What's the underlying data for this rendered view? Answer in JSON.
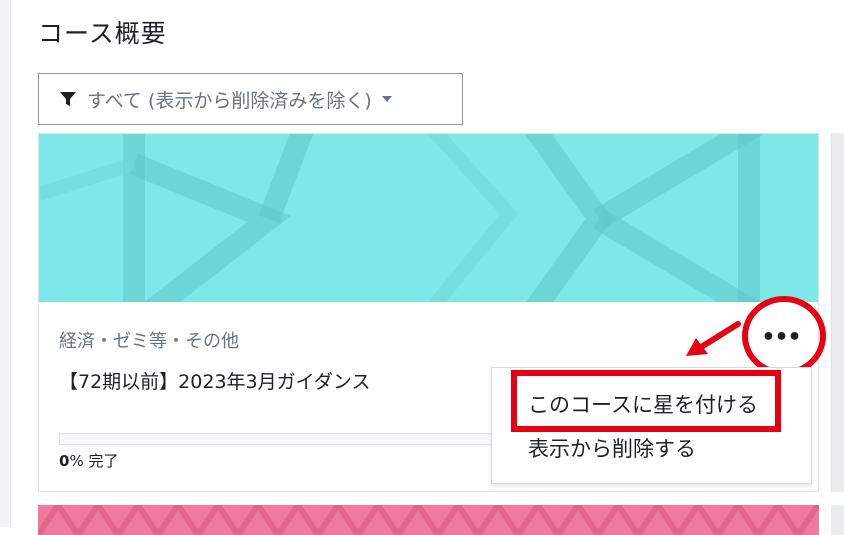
{
  "page": {
    "title": "コース概要"
  },
  "filter": {
    "label": "すべて (表示から削除済みを除く)"
  },
  "course": {
    "category": "経済・ゼミ等・その他",
    "name": "【72期以前】2023年3月ガイダンス",
    "progress_value": "0",
    "progress_suffix": "% 完了",
    "progress_fraction": 0.0,
    "image_color": "#7ee8e8"
  },
  "more_button": {
    "label": "•••"
  },
  "menu": {
    "items": [
      {
        "label": "このコースに星を付ける"
      },
      {
        "label": "表示から削除する"
      }
    ]
  },
  "colors": {
    "annotation": "#e60012",
    "next_card": "#f07aa0"
  },
  "icons": {
    "filter": "funnel-icon",
    "dropdown": "caret-down-icon",
    "more": "ellipsis-icon"
  }
}
